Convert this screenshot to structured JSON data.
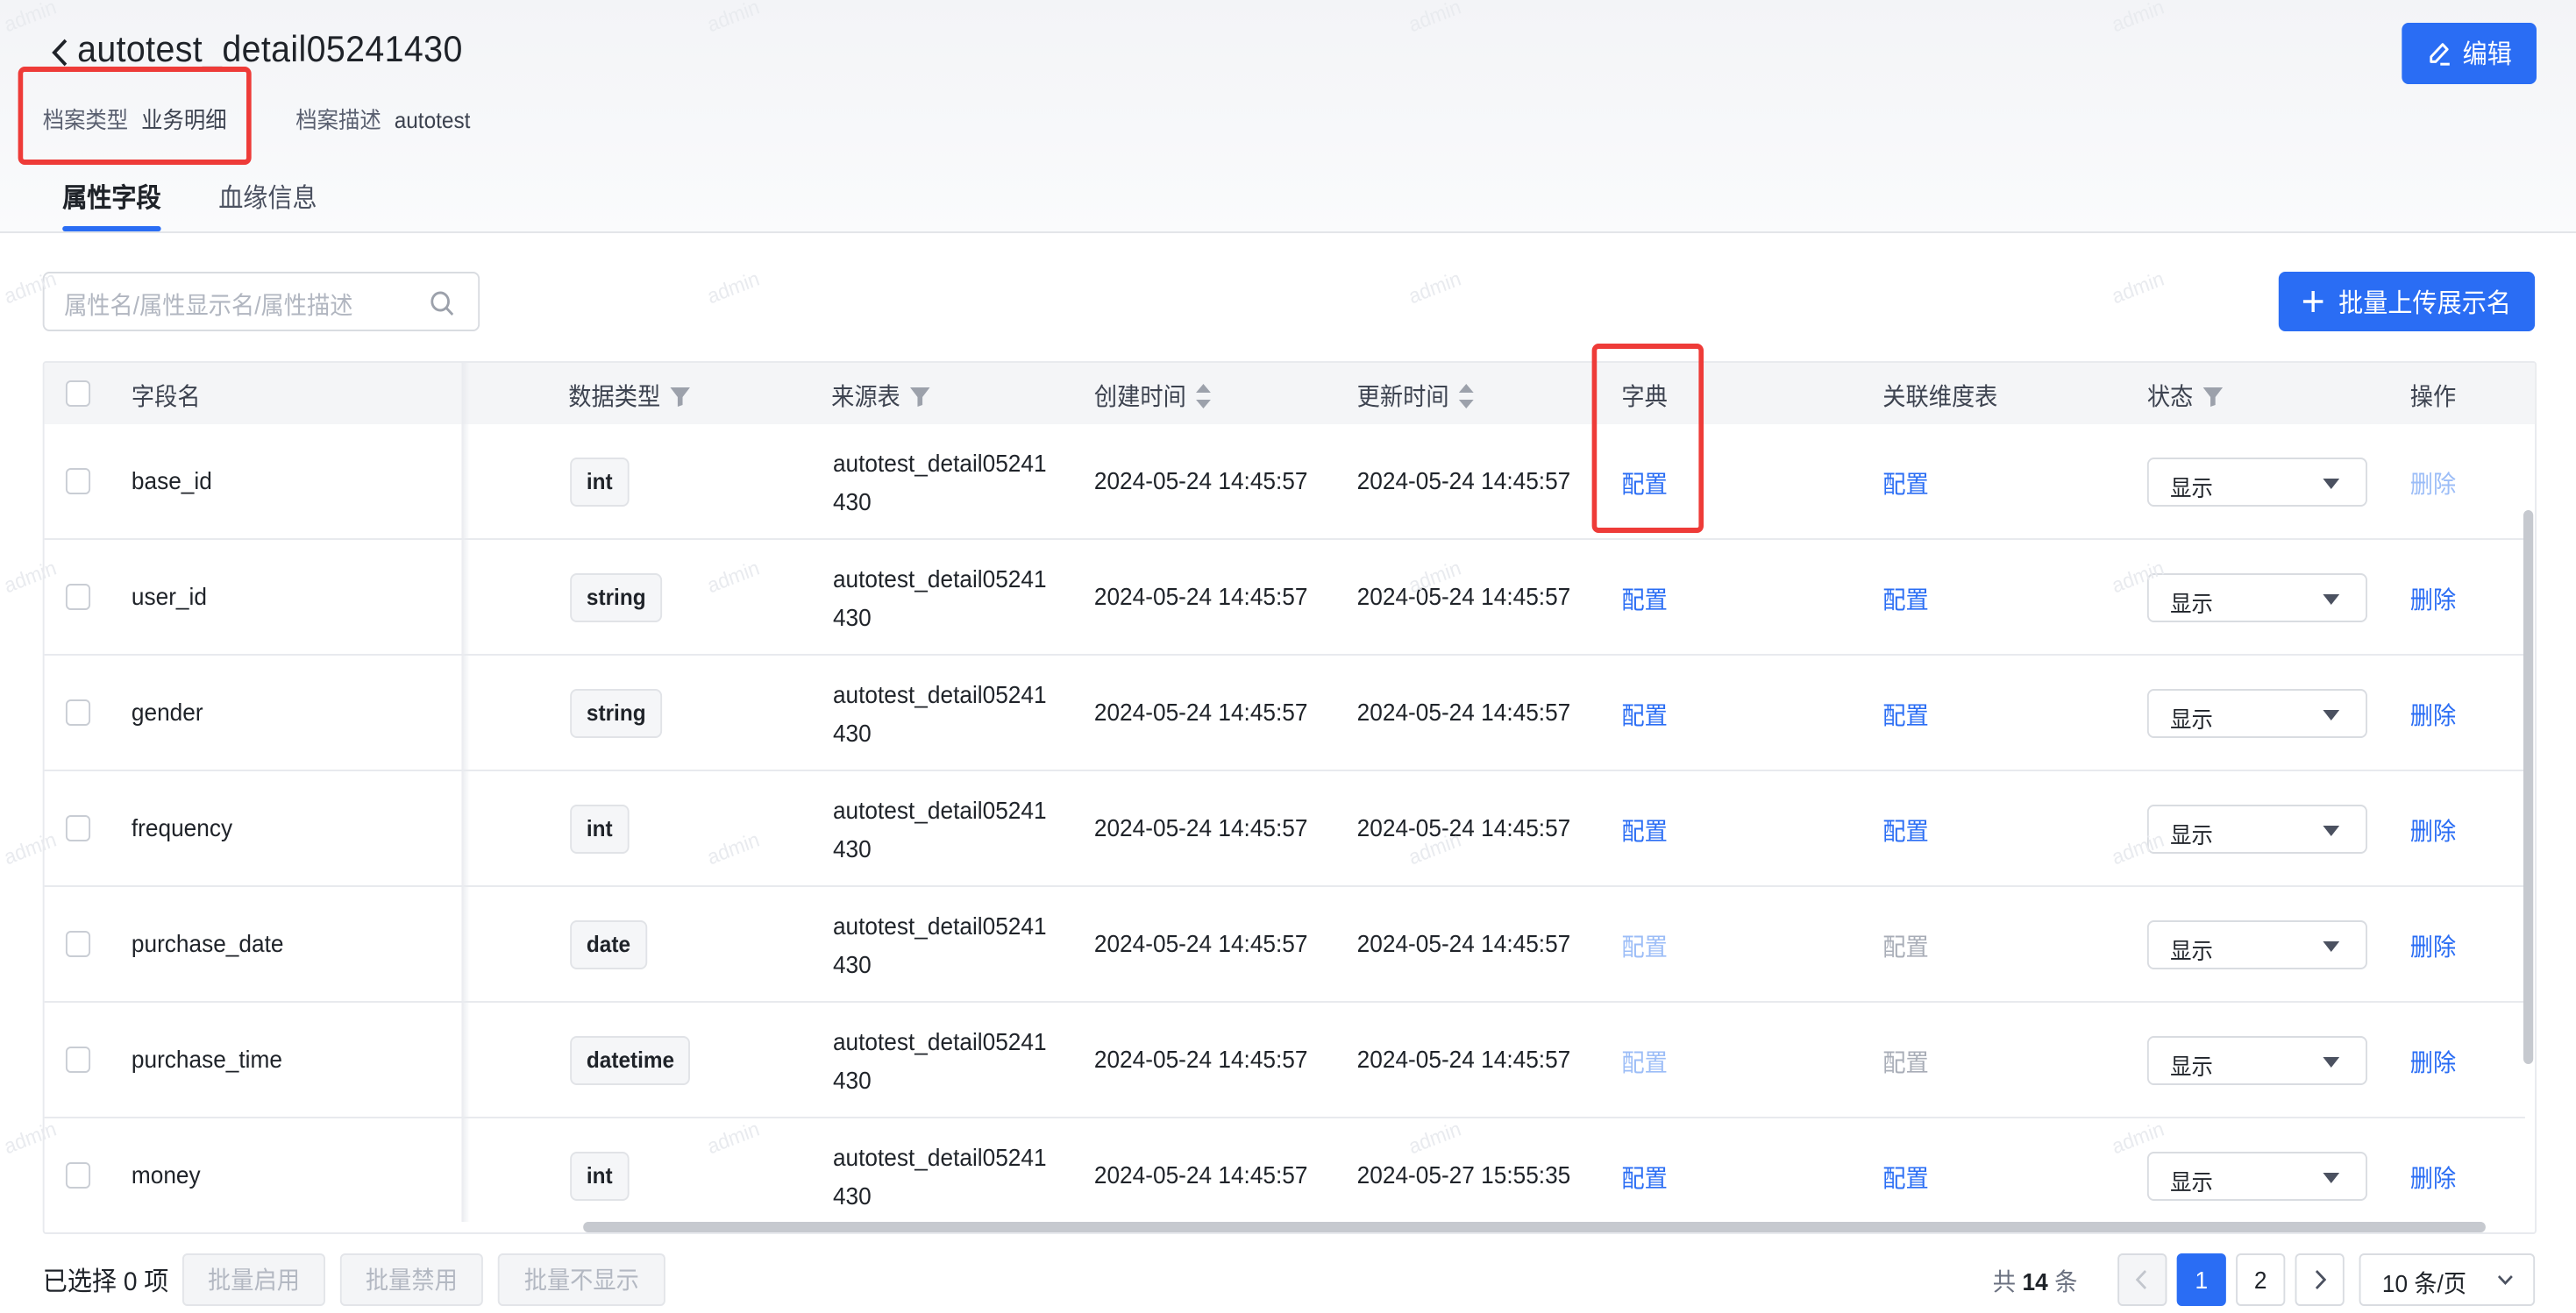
{
  "header": {
    "title": "autotest_detail05241430",
    "meta_type_label": "档案类型",
    "meta_type_value": "业务明细",
    "meta_desc_label": "档案描述",
    "meta_desc_value": "autotest",
    "edit_label": "编辑"
  },
  "tabs": [
    {
      "label": "属性字段",
      "active": true
    },
    {
      "label": "血缘信息",
      "active": false
    }
  ],
  "toolbar": {
    "search_placeholder": "属性名/属性显示名/属性描述",
    "upload_label": "批量上传展示名"
  },
  "table": {
    "columns": [
      "字段名",
      "数据类型",
      "来源表",
      "创建时间",
      "更新时间",
      "字典",
      "关联维度表",
      "状态",
      "操作"
    ],
    "rows": [
      {
        "name": "base_id",
        "type": "int",
        "src_line1": "autotest_detail05241",
        "src_line2": "430",
        "created": "2024-05-24 14:45:57",
        "updated": "2024-05-24 14:45:57",
        "dict": "配置",
        "dict_state": "active",
        "dim": "配置",
        "dim_state": "active",
        "status": "显示",
        "action": "删除",
        "action_state": "dim"
      },
      {
        "name": "user_id",
        "type": "string",
        "src_line1": "autotest_detail05241",
        "src_line2": "430",
        "created": "2024-05-24 14:45:57",
        "updated": "2024-05-24 14:45:57",
        "dict": "配置",
        "dict_state": "active",
        "dim": "配置",
        "dim_state": "active",
        "status": "显示",
        "action": "删除",
        "action_state": "active"
      },
      {
        "name": "gender",
        "type": "string",
        "src_line1": "autotest_detail05241",
        "src_line2": "430",
        "created": "2024-05-24 14:45:57",
        "updated": "2024-05-24 14:45:57",
        "dict": "配置",
        "dict_state": "active",
        "dim": "配置",
        "dim_state": "active",
        "status": "显示",
        "action": "删除",
        "action_state": "active"
      },
      {
        "name": "frequency",
        "type": "int",
        "src_line1": "autotest_detail05241",
        "src_line2": "430",
        "created": "2024-05-24 14:45:57",
        "updated": "2024-05-24 14:45:57",
        "dict": "配置",
        "dict_state": "active",
        "dim": "配置",
        "dim_state": "active",
        "status": "显示",
        "action": "删除",
        "action_state": "active"
      },
      {
        "name": "purchase_date",
        "type": "date",
        "src_line1": "autotest_detail05241",
        "src_line2": "430",
        "created": "2024-05-24 14:45:57",
        "updated": "2024-05-24 14:45:57",
        "dict": "配置",
        "dict_state": "dim",
        "dim": "配置",
        "dim_state": "gray",
        "status": "显示",
        "action": "删除",
        "action_state": "active"
      },
      {
        "name": "purchase_time",
        "type": "datetime",
        "src_line1": "autotest_detail05241",
        "src_line2": "430",
        "created": "2024-05-24 14:45:57",
        "updated": "2024-05-24 14:45:57",
        "dict": "配置",
        "dict_state": "dim",
        "dim": "配置",
        "dim_state": "gray",
        "status": "显示",
        "action": "删除",
        "action_state": "active"
      },
      {
        "name": "money",
        "type": "int",
        "src_line1": "autotest_detail05241",
        "src_line2": "430",
        "created": "2024-05-24 14:45:57",
        "updated": "2024-05-27 15:55:35",
        "dict": "配置",
        "dict_state": "active",
        "dim": "配置",
        "dim_state": "active",
        "status": "显示",
        "action": "删除",
        "action_state": "active"
      }
    ]
  },
  "footer": {
    "selected_text": "已选择 0 项",
    "batch_enable": "批量启用",
    "batch_disable": "批量禁用",
    "batch_hide": "批量不显示",
    "total_prefix": "共",
    "total_count": "14",
    "total_suffix": "条",
    "pages": [
      "1",
      "2"
    ],
    "current_page": "1",
    "page_size": "10 条/页"
  },
  "watermark": "admin",
  "colors": {
    "primary": "#2a6df4",
    "highlight": "#ee3b38"
  }
}
